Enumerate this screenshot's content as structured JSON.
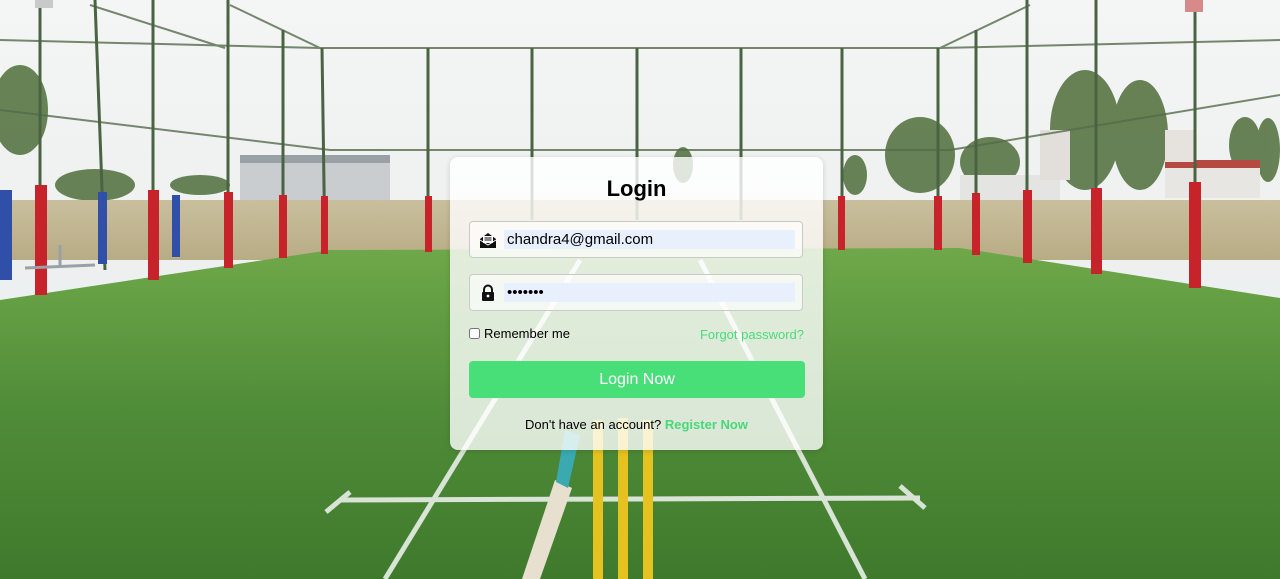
{
  "login": {
    "title": "Login",
    "email_value": "chandra4@gmail.com",
    "password_value": "chandra",
    "remember_label": "Remember me",
    "remember_checked": false,
    "forgot_label": "Forgot password?",
    "submit_label": "Login Now",
    "register_prompt": "Don't have an account?",
    "register_link": "Register Now"
  },
  "icons": {
    "email": "envelope-open-icon",
    "password": "lock-icon"
  },
  "colors": {
    "accent": "#48df79",
    "link": "#4bd97a",
    "input_autofill": "#e8f0fe"
  }
}
